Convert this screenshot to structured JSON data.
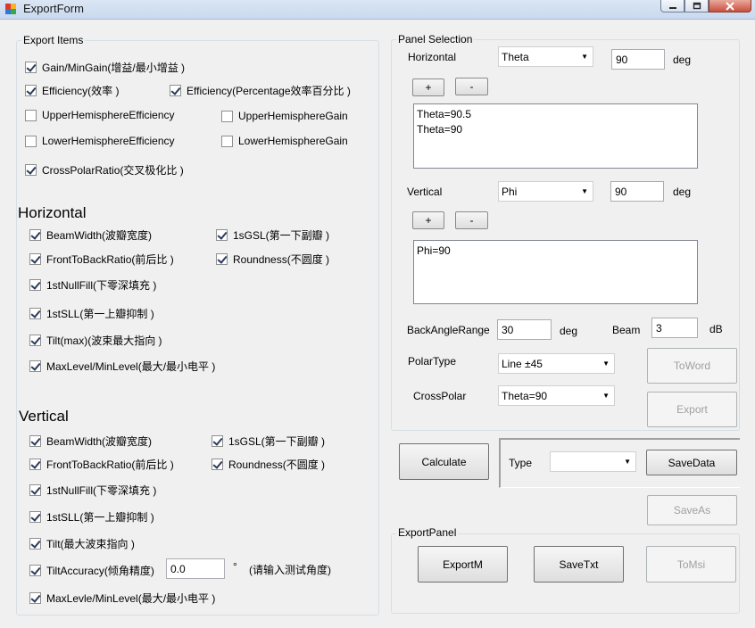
{
  "window": {
    "title": "ExportForm"
  },
  "export_items": {
    "label": "Export Items",
    "items": [
      {
        "label": "Gain/MinGain(增益/最小增益 )",
        "checked": true
      },
      {
        "label": "Efficiency(效率 )",
        "checked": true
      },
      {
        "label": "Efficiency(Percentage效率百分比 )",
        "checked": true
      },
      {
        "label": "UpperHemisphereEfficiency",
        "checked": false
      },
      {
        "label": "UpperHemisphereGain",
        "checked": false
      },
      {
        "label": "LowerHemisphereEfficiency",
        "checked": false
      },
      {
        "label": "LowerHemisphereGain",
        "checked": false
      },
      {
        "label": "CrossPolarRatio(交叉极化比 )",
        "checked": true
      }
    ]
  },
  "horizontal": {
    "title": "Horizontal",
    "items": [
      {
        "label": "BeamWidth(波瓣宽度)",
        "checked": true
      },
      {
        "label": "1sGSL(第一下副瓣 )",
        "checked": true
      },
      {
        "label": "FrontToBackRatio(前后比 )",
        "checked": true
      },
      {
        "label": "Roundness(不圆度 )",
        "checked": true
      },
      {
        "label": "1stNullFill(下零深填充 )",
        "checked": true
      },
      {
        "label": "1stSLL(第一上瓣抑制 )",
        "checked": true
      },
      {
        "label": "Tilt(max)(波束最大指向 )",
        "checked": true
      },
      {
        "label": "MaxLevel/MinLevel(最大/最小电平 )",
        "checked": true
      }
    ]
  },
  "vertical": {
    "title": "Vertical",
    "items": [
      {
        "label": "BeamWidth(波瓣宽度)",
        "checked": true
      },
      {
        "label": "1sGSL(第一下副瓣 )",
        "checked": true
      },
      {
        "label": "FrontToBackRatio(前后比 )",
        "checked": true
      },
      {
        "label": "Roundness(不圆度 )",
        "checked": true
      },
      {
        "label": "1stNullFill(下零深填充 )",
        "checked": true
      },
      {
        "label": "1stSLL(第一上瓣抑制 )",
        "checked": true
      },
      {
        "label": "Tilt(最大波束指向 )",
        "checked": true
      },
      {
        "label": "TiltAccuracy(倾角精度)",
        "checked": true
      },
      {
        "label": "MaxLevle/MinLevel(最大/最小电平 )",
        "checked": true
      }
    ],
    "tilt_accuracy_value": "0.0",
    "tilt_accuracy_unit": "°",
    "tilt_accuracy_hint": "(请输入测试角度)"
  },
  "panel_selection": {
    "label": "Panel Selection",
    "horizontal_label": "Horizontal",
    "horizontal_combo": "Theta",
    "horizontal_value": "90",
    "horizontal_unit": "deg",
    "plus": "+",
    "minus": "-",
    "horizontal_list": [
      "Theta=90.5",
      "Theta=90"
    ],
    "vertical_label": "Vertical",
    "vertical_combo": "Phi",
    "vertical_value": "90",
    "vertical_unit": "deg",
    "vertical_list": [
      "Phi=90"
    ],
    "back_angle_label": "BackAngleRange",
    "back_angle_value": "30",
    "back_angle_unit": "deg",
    "beam_label": "Beam",
    "beam_value": "3",
    "beam_unit": "dB",
    "polar_type_label": "PolarType",
    "polar_type_value": "Line ±45",
    "cross_polar_label": "CrossPolar",
    "cross_polar_value": "Theta=90",
    "toword": "ToWord",
    "export": "Export"
  },
  "actions": {
    "calculate": "Calculate",
    "type_label": "Type",
    "type_value": "",
    "savedata": "SaveData",
    "saveas": "SaveAs"
  },
  "export_panel": {
    "label": "ExportPanel",
    "exportm": "ExportM",
    "savetxt": "SaveTxt",
    "tomsi": "ToMsi"
  }
}
